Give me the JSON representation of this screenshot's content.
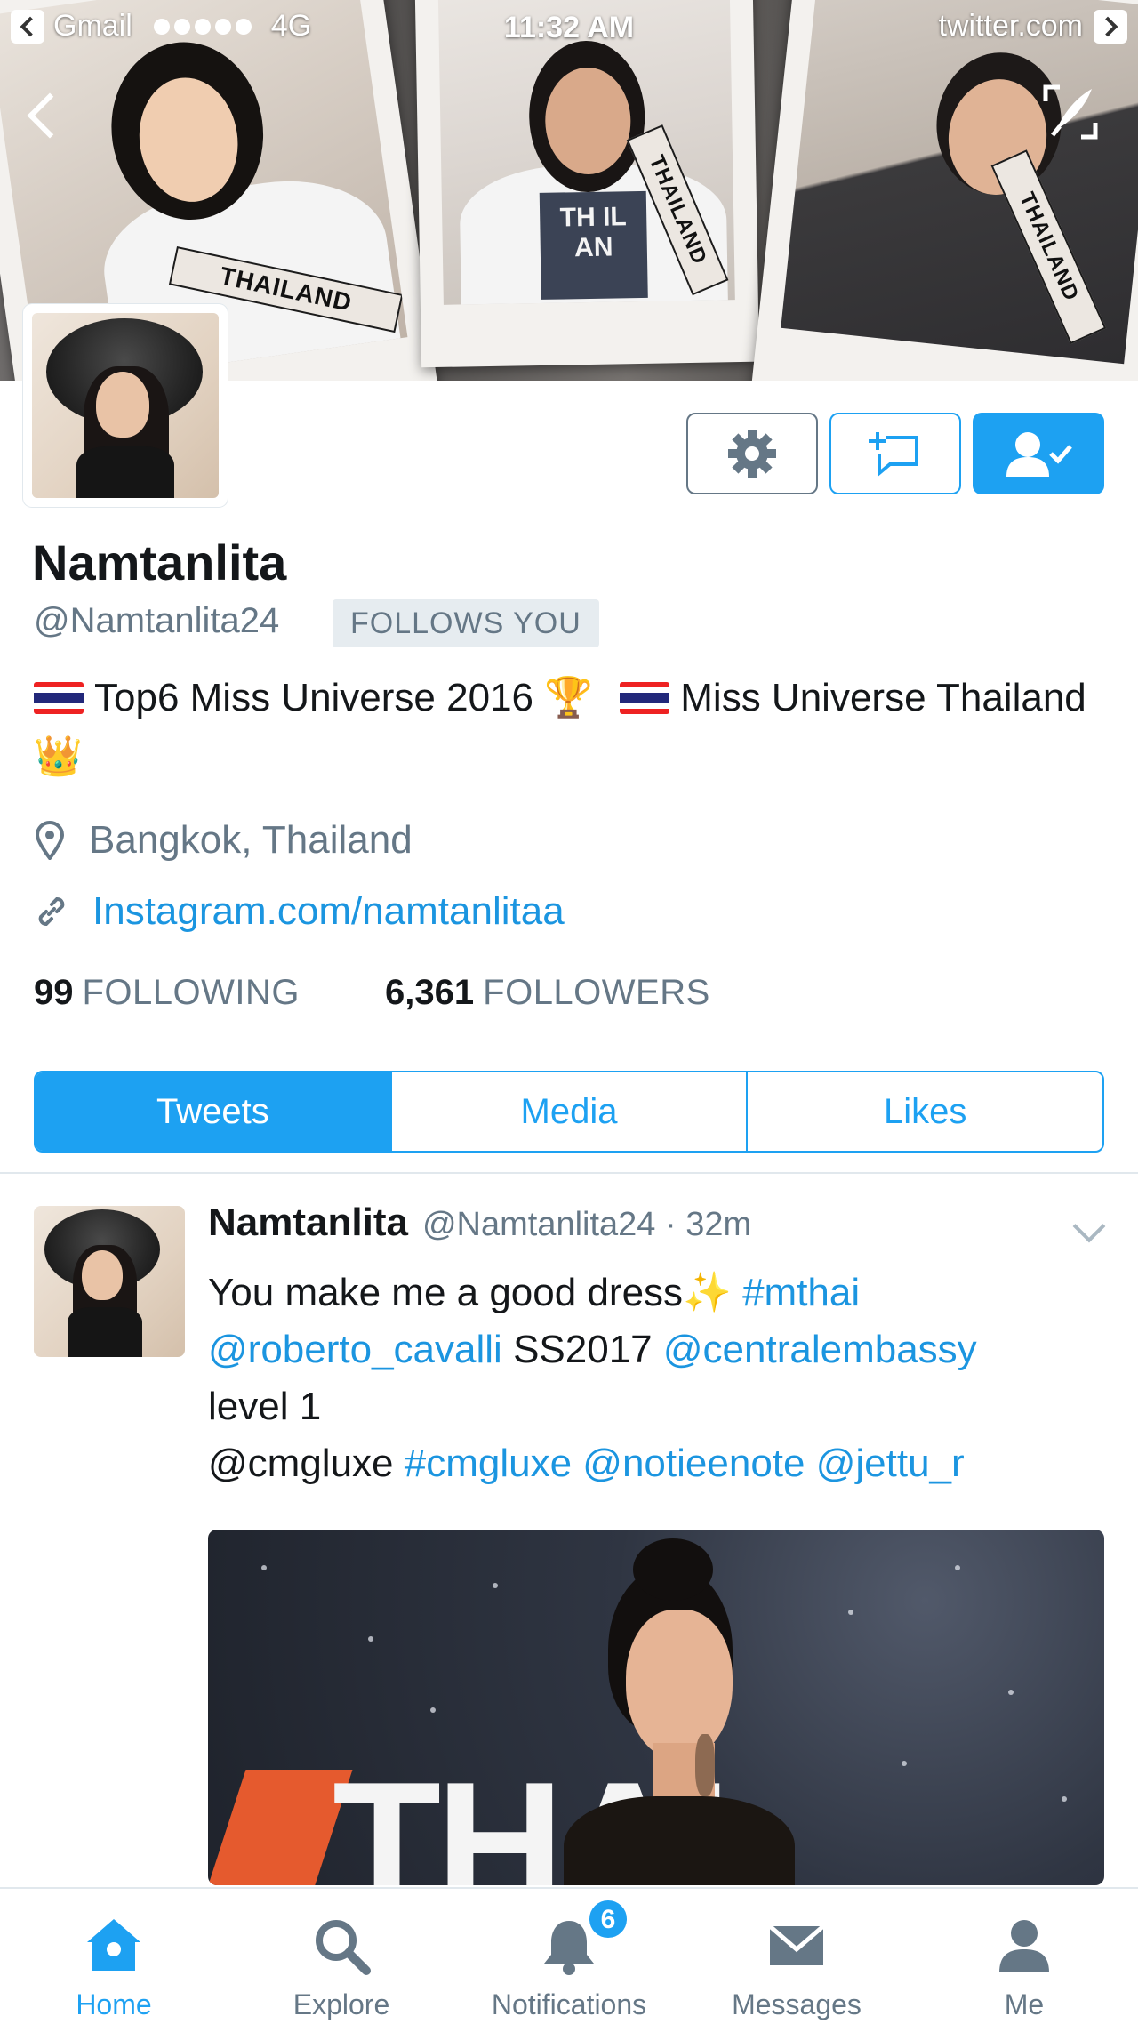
{
  "status_bar": {
    "back_app": "Gmail",
    "network": "4G",
    "time": "11:32 AM",
    "site": "twitter.com"
  },
  "banner": {
    "sash_text": "THAILAND",
    "shirt_text": "TH IL AN"
  },
  "profile": {
    "name": "Namtanlita",
    "handle": "@Namtanlita24",
    "follows_you": "FOLLOWS YOU",
    "bio_part1": "Top6 Miss Universe 2016",
    "bio_emoji1": "🏆",
    "bio_part2": "Miss Universe Thailand",
    "bio_emoji2": "👑",
    "location": "Bangkok, Thailand",
    "link": "Instagram.com/namtanlitaa",
    "following_count": "99",
    "following_label": "FOLLOWING",
    "followers_count": "6,361",
    "followers_label": "FOLLOWERS"
  },
  "tabs": [
    {
      "label": "Tweets",
      "active": true
    },
    {
      "label": "Media",
      "active": false
    },
    {
      "label": "Likes",
      "active": false
    }
  ],
  "tweet": {
    "name": "Namtanlita",
    "meta": "@Namtanlita24 · 32m",
    "line1_text": "You make me a good dress",
    "line1_emoji": "✨",
    "line1_tag": "#mthai",
    "line2_mention": "@roberto_cavalli",
    "line2_text": "SS2017",
    "line2_mention2": "@centralembassy",
    "line3_text": "level 1",
    "line4_text": "@cmgluxe",
    "line4_tag": "#cmgluxe",
    "line4_mention1": "@notieenote",
    "line4_mention2": "@jettu_r",
    "media_logo": "THAI"
  },
  "bottom_nav": [
    {
      "label": "Home",
      "icon": "home-icon",
      "active": true
    },
    {
      "label": "Explore",
      "icon": "search-icon",
      "active": false
    },
    {
      "label": "Notifications",
      "icon": "bell-icon",
      "active": false,
      "badge": "6"
    },
    {
      "label": "Messages",
      "icon": "envelope-icon",
      "active": false
    },
    {
      "label": "Me",
      "icon": "person-icon",
      "active": false
    }
  ],
  "colors": {
    "accent": "#1da1f2",
    "link": "#1b95e0",
    "muted": "#657786",
    "text": "#14171a"
  }
}
